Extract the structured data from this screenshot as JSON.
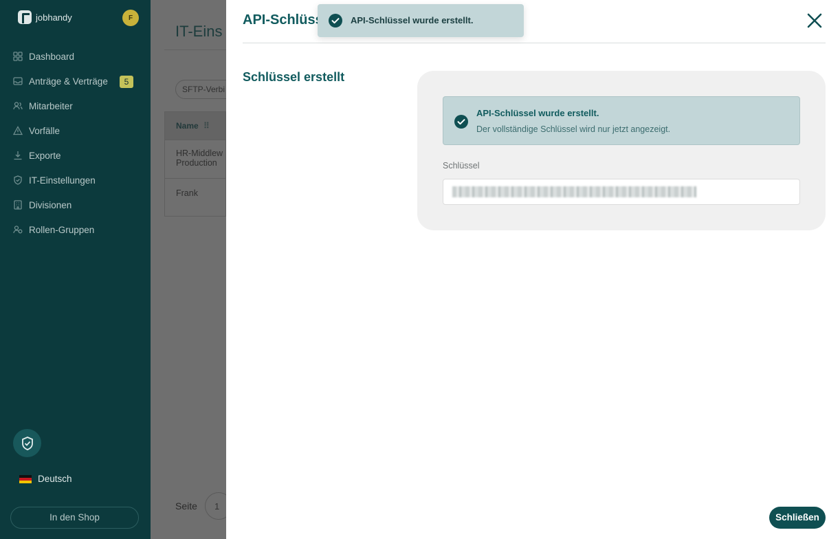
{
  "app": {
    "name": "jobhandy",
    "avatar_initial": "F"
  },
  "sidebar": {
    "items": [
      {
        "label": "Dashboard",
        "icon": "grid-icon"
      },
      {
        "label": "Anträge & Verträge",
        "icon": "inbox-icon",
        "badge": "5"
      },
      {
        "label": "Mitarbeiter",
        "icon": "users-icon"
      },
      {
        "label": "Vorfälle",
        "icon": "warning-icon"
      },
      {
        "label": "Exporte",
        "icon": "download-icon"
      },
      {
        "label": "IT-Einstellungen",
        "icon": "shield-icon"
      },
      {
        "label": "Divisionen",
        "icon": "building-icon"
      },
      {
        "label": "Rollen-Gruppen",
        "icon": "user-group-icon"
      }
    ],
    "language": "Deutsch",
    "shop_label": "In den Shop"
  },
  "background": {
    "title": "IT-Eins",
    "chip": "SFTP-Verbi",
    "table_header": "Name",
    "rows": [
      "HR-Middlew\nProduction",
      "Frank"
    ],
    "pagination_label": "Seite",
    "page_number": "1"
  },
  "modal": {
    "title": "API-Schlüss",
    "section_title": "Schlüssel erstellt",
    "alert_title": "API-Schlüssel wurde erstellt.",
    "alert_subtitle": "Der vollständige Schlüssel wird nur jetzt angezeigt.",
    "field_label": "Schlüssel",
    "field_value": "••••••••••••••••••••••••••••••••••••••••",
    "close_button": "Schließen"
  },
  "toast": {
    "message": "API-Schlüssel wurde erstellt."
  },
  "colors": {
    "sidebar_bg": "#0c3a3d",
    "accent": "#115b5e",
    "alert_bg": "#c2d6d8",
    "badge": "#c4c25a"
  }
}
